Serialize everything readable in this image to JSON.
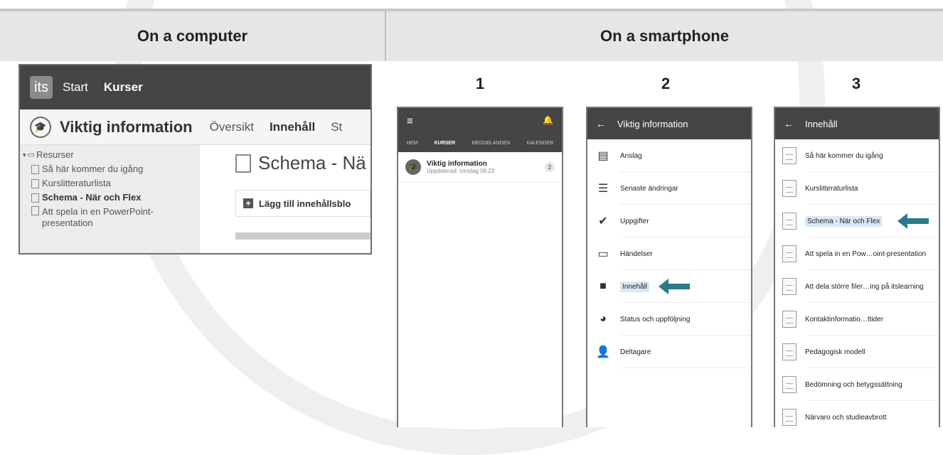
{
  "headers": {
    "left": "On a computer",
    "right": "On a smartphone"
  },
  "desktop": {
    "logo": "its",
    "nav": [
      "Start",
      "Kurser"
    ],
    "course_title": "Viktig information",
    "tabs": [
      "Översikt",
      "Innehåll",
      "St"
    ],
    "tree_root": "Resurser",
    "tree_items": [
      "Så här kommer du igång",
      "Kurslitteraturlista",
      "Schema - När och Flex",
      "Att spela in en PowerPoint-presentation"
    ],
    "content_title": "Schema - Nä",
    "add_block": "Lägg till innehållsblo"
  },
  "phone_numbers": [
    "1",
    "2",
    "3"
  ],
  "phone1": {
    "tabs": [
      "HEM",
      "KURSER",
      "MEDDELANDEN",
      "KALENDER"
    ],
    "item_title": "Viktig information",
    "item_sub": "Uppdaterad: torsdag 08:23",
    "badge": "2"
  },
  "phone2": {
    "title": "Viktig information",
    "items": [
      "Anslag",
      "Senaste ändringar",
      "Uppgifter",
      "Händelser",
      "Innehåll",
      "Status och uppföljning",
      "Deltagare"
    ]
  },
  "phone3": {
    "title": "Innehåll",
    "items": [
      "Så här kommer du igång",
      "Kurslitteraturlista",
      "Schema - När och Flex",
      "Att spela in en Pow…oint-presentation",
      "Att dela större filer…ing på itslearning",
      "Kontaktinformatio…ttider",
      "Pedagogisk modell",
      "Bedömning och betygssättning",
      "Närvaro och studieavbrott"
    ]
  },
  "colors": {
    "arrow": "#2a7a8c",
    "highlight": "#d9e8f6",
    "dark": "#454545"
  }
}
